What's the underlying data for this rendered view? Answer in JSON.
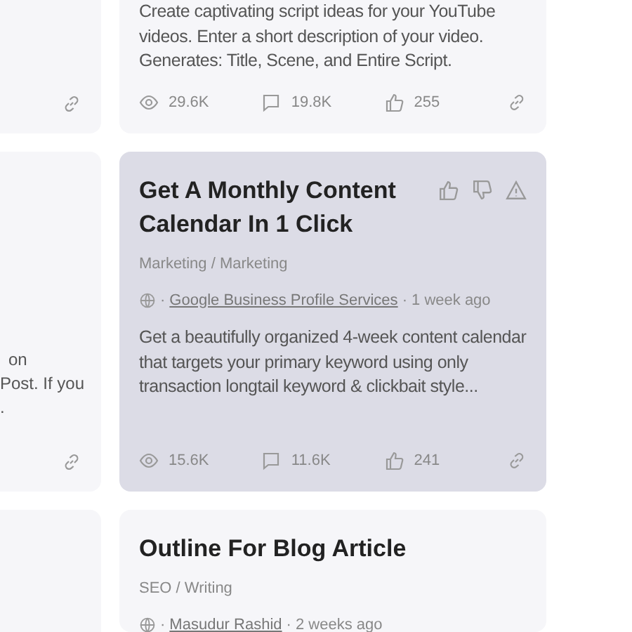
{
  "left_cards": [
    {
      "kind": "bottom",
      "link_icon": true
    },
    {
      "kind": "whole",
      "lines": [
        "on",
        "Post. If you",
        "."
      ],
      "link_icon": true
    },
    {
      "kind": "top"
    }
  ],
  "cards": [
    {
      "highlighted": false,
      "description": "Create captivating script ideas for your YouTube videos. Enter a short description of your video. Generates: Title, Scene, and Entire Script.",
      "stats": {
        "views": "29.6K",
        "comments": "19.8K",
        "likes": "255"
      }
    },
    {
      "highlighted": true,
      "title": "Get A Monthly Content Calendar In 1 Click",
      "category": "Marketing / Marketing",
      "meta": {
        "prefix": "·",
        "author": "Google Business Profile Services",
        "time": "· 1 week ago"
      },
      "description": "Get a beautifully organized 4-week content calendar that targets your primary keyword using only transaction longtail keyword & clickbait style...",
      "stats": {
        "views": "15.6K",
        "comments": "11.6K",
        "likes": "241"
      }
    },
    {
      "highlighted": false,
      "title": "Outline For Blog Article",
      "category": "SEO / Writing",
      "meta": {
        "prefix": "·",
        "author": "Masudur Rashid",
        "time": "· 2 weeks ago"
      }
    }
  ]
}
